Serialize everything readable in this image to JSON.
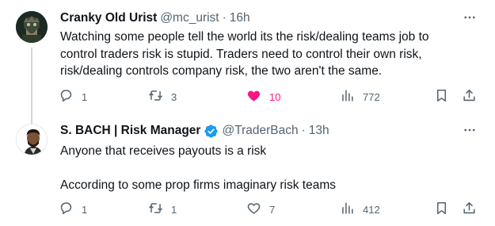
{
  "tweets": [
    {
      "author": {
        "name": "Cranky Old Urist",
        "handle": "@mc_urist",
        "verified": false
      },
      "time": "16h",
      "text": [
        "Watching some people tell the world its the risk/dealing teams job to",
        "control traders risk is stupid. Traders need to control their own risk,",
        "risk/dealing controls company risk, the two aren't the same."
      ],
      "stats": {
        "replies": "1",
        "retweets": "3",
        "likes": "10",
        "views": "772"
      },
      "liked": true
    },
    {
      "author": {
        "name": "S. BACH | Risk Manager",
        "handle": "@TraderBach",
        "verified": true
      },
      "time": "13h",
      "text": [
        "Anyone that receives payouts is a risk",
        "According to some prop firms imaginary risk teams"
      ],
      "stats": {
        "replies": "1",
        "retweets": "1",
        "likes": "7",
        "views": "412"
      },
      "liked": false
    }
  ],
  "colors": {
    "like_active": "#f91880",
    "verified": "#1d9bf0",
    "muted": "#536471",
    "thread_line": "#cfd9de"
  },
  "icons": [
    "reply-icon",
    "retweet-icon",
    "heart-icon",
    "views-icon",
    "bookmark-icon",
    "share-icon",
    "more-icon",
    "verified-badge-icon"
  ]
}
